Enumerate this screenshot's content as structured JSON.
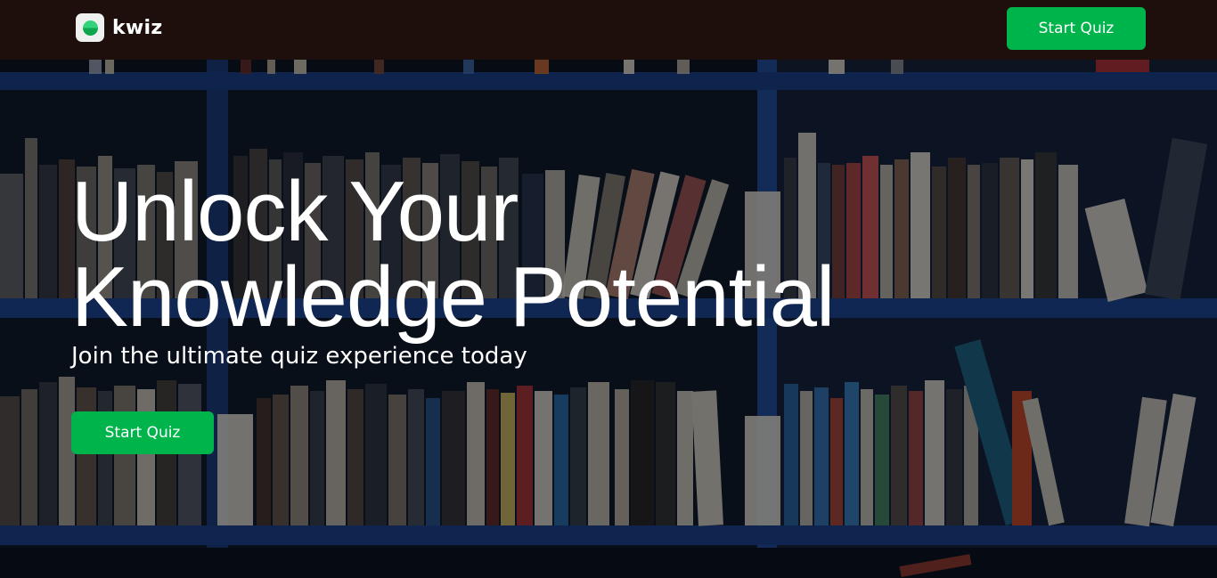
{
  "brand": {
    "name": "kwiz",
    "icon": "logo-icon",
    "accent": "#00b44c"
  },
  "navbar": {
    "cta_label": "Start Quiz",
    "bg_color": "#1e0f0d"
  },
  "hero": {
    "headline_line1": "Unlock Your",
    "headline_line2": "Knowledge Potential",
    "subheadline": "Join the ultimate quiz experience today",
    "cta_label": "Start Quiz",
    "background": "bookshelf-photo"
  }
}
